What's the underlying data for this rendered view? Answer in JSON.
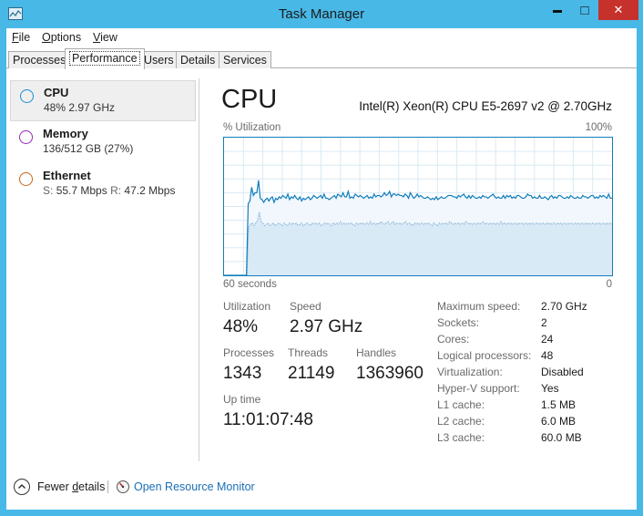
{
  "window": {
    "title": "Task Manager",
    "minimize_glyph": "▬",
    "maximize_glyph": "□",
    "close_glyph": "✕"
  },
  "menu": {
    "file": {
      "accel": "F",
      "rest": "ile"
    },
    "options": {
      "accel": "O",
      "rest": "ptions"
    },
    "view": {
      "accel": "V",
      "rest": "iew"
    }
  },
  "tabs": [
    "Processes",
    "Performance",
    "Users",
    "Details",
    "Services"
  ],
  "active_tab": "Performance",
  "resources": [
    {
      "name": "CPU",
      "detail": "48%  2.97 GHz",
      "color": "#1a8ed8"
    },
    {
      "name": "Memory",
      "detail": "136/512 GB (27%)",
      "color": "#9528b4"
    },
    {
      "name": "Ethernet",
      "send_prefix": "S:",
      "send": "55.7 Mbps",
      "recv_prefix": "R:",
      "recv": "47.2 Mbps",
      "color": "#a74f01"
    }
  ],
  "cpu": {
    "title": "CPU",
    "model": "Intel(R) Xeon(R) CPU E5-2697 v2 @ 2.70GHz",
    "graph": {
      "y_label": "% Utilization",
      "y_max_label": "100%",
      "x_left_label": "60 seconds",
      "x_right_label": "0",
      "line_color": "#117dbb",
      "fill_color": "#d9eaf7",
      "total_series": [
        0,
        0,
        0,
        0,
        0,
        0,
        0,
        0,
        0,
        0,
        0,
        0,
        0,
        0,
        52,
        54,
        64,
        58,
        60,
        60,
        69,
        56,
        55,
        53,
        55,
        56,
        54,
        56,
        57,
        53,
        56,
        55,
        57,
        56,
        58,
        57,
        56,
        59,
        55,
        57,
        56,
        58,
        56,
        55,
        57,
        54,
        56,
        55,
        56,
        57,
        55,
        56,
        58,
        57,
        56,
        57,
        58,
        56,
        59,
        56,
        56,
        55,
        56,
        57,
        58,
        56,
        59,
        58,
        57,
        60,
        57,
        57,
        61,
        56,
        57,
        56,
        59,
        58,
        57,
        58,
        57,
        56,
        57,
        58,
        56,
        57,
        56,
        59,
        57,
        58,
        58,
        57,
        58,
        60,
        58,
        59,
        61,
        57,
        59,
        59,
        58,
        59,
        58,
        58,
        57,
        59,
        58,
        56,
        60,
        58,
        56,
        57,
        59,
        57,
        58,
        57,
        56,
        56,
        57,
        56,
        55,
        56,
        55,
        57,
        55,
        56,
        57,
        56,
        56,
        57,
        58,
        58,
        58,
        57,
        57,
        56,
        58,
        57,
        58,
        59,
        57,
        56,
        58,
        56,
        58,
        57,
        56,
        56,
        57,
        56,
        58,
        57,
        57,
        56,
        57,
        58,
        59,
        57,
        56,
        57,
        56,
        56,
        58,
        56,
        58,
        57,
        58,
        56,
        57,
        56,
        58,
        58,
        57,
        56,
        56,
        57,
        59,
        58,
        58,
        56,
        57,
        56,
        56,
        58,
        56,
        56,
        57,
        56,
        55,
        57,
        58,
        56,
        57,
        56,
        58,
        58,
        57,
        56,
        56,
        57,
        56,
        58,
        57,
        56,
        56,
        57,
        56,
        56,
        58,
        57,
        57,
        56,
        57,
        58,
        58,
        56,
        57,
        56,
        58,
        57,
        58,
        57,
        56,
        59,
        56,
        56
      ],
      "kernel_series": [
        0,
        0,
        0,
        0,
        0,
        0,
        0,
        0,
        0,
        0,
        0,
        0,
        0,
        0,
        35,
        37,
        38,
        36,
        38,
        40,
        46,
        39,
        38,
        36,
        37,
        38,
        36,
        37,
        38,
        36,
        37,
        38,
        37,
        36,
        38,
        37,
        36,
        38,
        37,
        38,
        37,
        38,
        36,
        37,
        38,
        36,
        37,
        38,
        37,
        36,
        38,
        37,
        38,
        37,
        38,
        36,
        37,
        38,
        37,
        38,
        37,
        36,
        38,
        37,
        38,
        37,
        39,
        37,
        38,
        37,
        38,
        37,
        38,
        37,
        36,
        38,
        37,
        38,
        37,
        38,
        37,
        38,
        37,
        39,
        37,
        38,
        37,
        38,
        37,
        39,
        38,
        37,
        38,
        39,
        37,
        38,
        39,
        37,
        38,
        37,
        38,
        37,
        38,
        39,
        37,
        38,
        37,
        36,
        38,
        37,
        38,
        37,
        38,
        37,
        38,
        37,
        38,
        37,
        36,
        38,
        37,
        36,
        38,
        37,
        38,
        37,
        38,
        37,
        39,
        38,
        37,
        38,
        37,
        38,
        37,
        38,
        37,
        39,
        38,
        37,
        38,
        37,
        38,
        37,
        38,
        37,
        38,
        39,
        37,
        38,
        37,
        38,
        37,
        38,
        37,
        38,
        37,
        39,
        37,
        38,
        37,
        38,
        37,
        38,
        37,
        38,
        37,
        38,
        37,
        38,
        37,
        38,
        37,
        38,
        37,
        38,
        37,
        38,
        37,
        38,
        37,
        38,
        37,
        38,
        37,
        38,
        37,
        38,
        37,
        38,
        37,
        38,
        37,
        38,
        37,
        38,
        37,
        38,
        37,
        38,
        37,
        38,
        37,
        38,
        37,
        38,
        37,
        38,
        37,
        38,
        37,
        38,
        37,
        38,
        37,
        38,
        37,
        38,
        37,
        38,
        37
      ]
    },
    "stats": {
      "utilization_label": "Utilization",
      "utilization": "48%",
      "speed_label": "Speed",
      "speed": "2.97 GHz",
      "processes_label": "Processes",
      "processes": "1343",
      "threads_label": "Threads",
      "threads": "21149",
      "handles_label": "Handles",
      "handles": "1363960",
      "uptime_label": "Up time",
      "uptime": "11:01:07:48"
    },
    "details": [
      {
        "label": "Maximum speed:",
        "value": "2.70 GHz"
      },
      {
        "label": "Sockets:",
        "value": "2"
      },
      {
        "label": "Cores:",
        "value": "24"
      },
      {
        "label": "Logical processors:",
        "value": "48"
      },
      {
        "label": "Virtualization:",
        "value": "Disabled"
      },
      {
        "label": "Hyper-V support:",
        "value": "Yes"
      },
      {
        "label": "L1 cache:",
        "value": "1.5 MB"
      },
      {
        "label": "L2 cache:",
        "value": "6.0 MB"
      },
      {
        "label": "L3 cache:",
        "value": "60.0 MB"
      }
    ]
  },
  "footer": {
    "fewer_details": {
      "prefix": "Fewer ",
      "accel": "d",
      "rest": "etails"
    },
    "resource_monitor": "Open Resource Monitor"
  }
}
